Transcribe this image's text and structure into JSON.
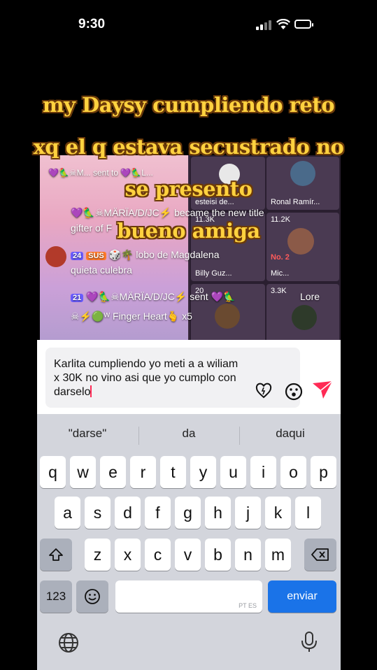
{
  "status_bar": {
    "time": "9:30"
  },
  "overlay": {
    "lines": [
      "my Daysy cumpliendo reto",
      "xq el q estava secustrado no",
      "se presento",
      "bueno amiga"
    ]
  },
  "live_feed": {
    "top_row": "💜🦜☠M... sent to 💜🦜L...",
    "gift_line": "💜🦜☠MÄRÏA/D/JC⚡ became the new title",
    "gifter": "gifter of F",
    "user_line_badge1": "24",
    "user_line_badge2": "SUS",
    "user_line": "🎲🌴 lobo de Magdalena",
    "user_line2": "quieta culebra",
    "sent_line_badge": "21",
    "sent_line": "💜🦜☠MÄRÏA/D/JC⚡ sent 💜🦜",
    "gift_name": "☠⚡🟢ᵂ Finger Heart🫰 x5",
    "tiles": [
      {
        "name": "esteisi de...",
        "count": "11.3K"
      },
      {
        "name": "Ronal Ramír...",
        "count": "11.2K"
      },
      {
        "name": "Billy Guz...",
        "count": "20"
      },
      {
        "name": "Mic...",
        "tag": "No. 2",
        "count": "3.3K"
      }
    ],
    "lore": "Lore"
  },
  "composer": {
    "text": "Karlita cumpliendo yo meti a a wiliam x 30K no vino asi que yo cumplo con darselo"
  },
  "keyboard": {
    "suggestions": [
      "\"darse\"",
      "da",
      "daqui"
    ],
    "row1": [
      "q",
      "w",
      "e",
      "r",
      "t",
      "y",
      "u",
      "i",
      "o",
      "p"
    ],
    "row2": [
      "a",
      "s",
      "d",
      "f",
      "g",
      "h",
      "j",
      "k",
      "l"
    ],
    "row3": [
      "z",
      "x",
      "c",
      "v",
      "b",
      "n",
      "m"
    ],
    "numbers_key": "123",
    "space_langs": "PT ES",
    "return_key": "enviar"
  },
  "colors": {
    "overlay_text": "#ffd23f",
    "send_accent": "#ff2a55",
    "return_key": "#1a73e8"
  }
}
